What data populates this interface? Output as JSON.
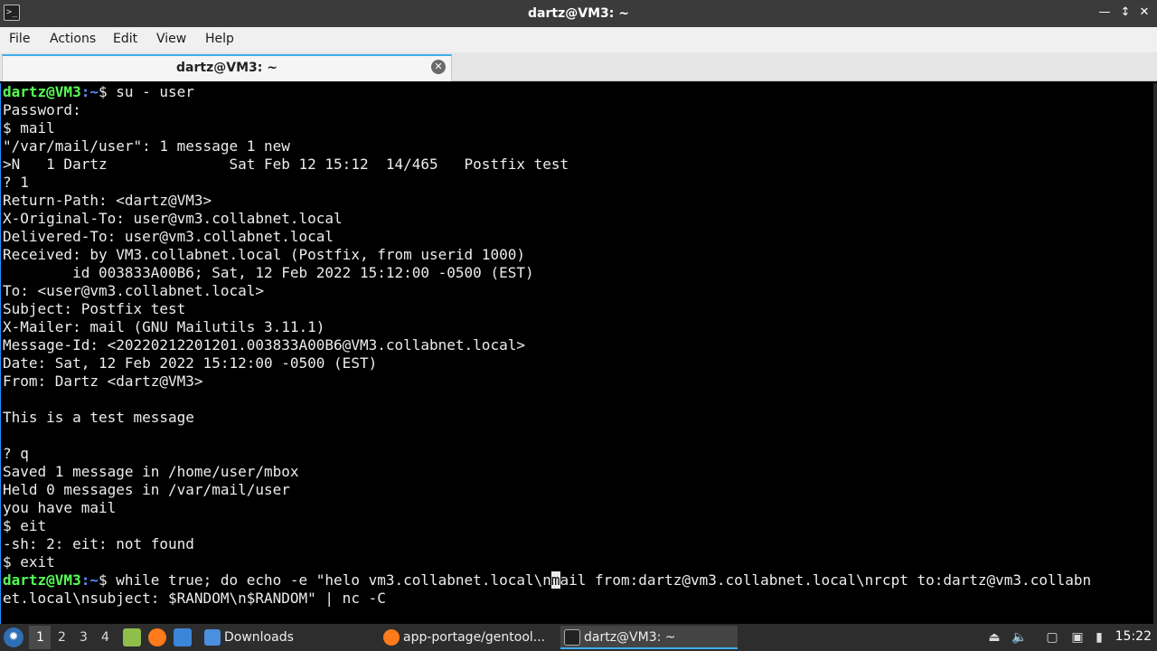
{
  "window": {
    "title": "dartz@VM3: ~",
    "icon": "terminal-icon"
  },
  "menu": [
    "File",
    "Actions",
    "Edit",
    "View",
    "Help"
  ],
  "tab": {
    "label": "dartz@VM3: ~",
    "close_icon": "close-icon"
  },
  "terminal": {
    "prompt_user": "dartz@VM3",
    "prompt_path": ":~",
    "prompt_symbol": "$ ",
    "lines": [
      {
        "type": "prompt",
        "text": "su - user"
      },
      {
        "type": "text",
        "text": "Password:"
      },
      {
        "type": "text",
        "text": "$ mail"
      },
      {
        "type": "text",
        "text": "\"/var/mail/user\": 1 message 1 new"
      },
      {
        "type": "text",
        "text": ">N   1 Dartz              Sat Feb 12 15:12  14/465   Postfix test"
      },
      {
        "type": "text",
        "text": "? 1"
      },
      {
        "type": "text",
        "text": "Return-Path: <dartz@VM3>"
      },
      {
        "type": "text",
        "text": "X-Original-To: user@vm3.collabnet.local"
      },
      {
        "type": "text",
        "text": "Delivered-To: user@vm3.collabnet.local"
      },
      {
        "type": "text",
        "text": "Received: by VM3.collabnet.local (Postfix, from userid 1000)"
      },
      {
        "type": "text",
        "text": "        id 003833A00B6; Sat, 12 Feb 2022 15:12:00 -0500 (EST)"
      },
      {
        "type": "text",
        "text": "To: <user@vm3.collabnet.local>"
      },
      {
        "type": "text",
        "text": "Subject: Postfix test"
      },
      {
        "type": "text",
        "text": "X-Mailer: mail (GNU Mailutils 3.11.1)"
      },
      {
        "type": "text",
        "text": "Message-Id: <20220212201201.003833A00B6@VM3.collabnet.local>"
      },
      {
        "type": "text",
        "text": "Date: Sat, 12 Feb 2022 15:12:00 -0500 (EST)"
      },
      {
        "type": "text",
        "text": "From: Dartz <dartz@VM3>"
      },
      {
        "type": "text",
        "text": ""
      },
      {
        "type": "text",
        "text": "This is a test message"
      },
      {
        "type": "text",
        "text": ""
      },
      {
        "type": "text",
        "text": "? q"
      },
      {
        "type": "text",
        "text": "Saved 1 message in /home/user/mbox"
      },
      {
        "type": "text",
        "text": "Held 0 messages in /var/mail/user"
      },
      {
        "type": "text",
        "text": "you have mail"
      },
      {
        "type": "text",
        "text": "$ eit"
      },
      {
        "type": "text",
        "text": "-sh: 2: eit: not found"
      },
      {
        "type": "text",
        "text": "$ exit"
      }
    ],
    "current_command_before_cursor": "while true; do echo -e \"helo vm3.collabnet.local\\n",
    "cursor_char": "m",
    "current_command_after_cursor": "ail from:dartz@vm3.collabnet.local\\nrcpt to:dartz@vm3.collabn",
    "current_command_wrap": "et.local\\nsubject: $RANDOM\\n$RANDOM\" | nc -C"
  },
  "taskbar": {
    "start_icon": "start-menu-icon",
    "workspaces": [
      "1",
      "2",
      "3",
      "4"
    ],
    "launchers": [
      "file-manager-icon",
      "firefox-icon",
      "desktop-icon"
    ],
    "tasks": [
      {
        "label": "Downloads",
        "icon": "folder-icon"
      },
      {
        "label": "app-portage/gentool...",
        "icon": "firefox-icon"
      },
      {
        "label": "dartz@VM3: ~",
        "icon": "terminal-icon"
      }
    ],
    "tray": [
      "eject-icon",
      "volume-icon",
      "clipboard-icon",
      "network-icon",
      "battery-icon"
    ],
    "clock": "15:22"
  },
  "colors": {
    "prompt_user": "#55ff55",
    "prompt_path": "#5c8cff",
    "accent": "#3daee9"
  }
}
